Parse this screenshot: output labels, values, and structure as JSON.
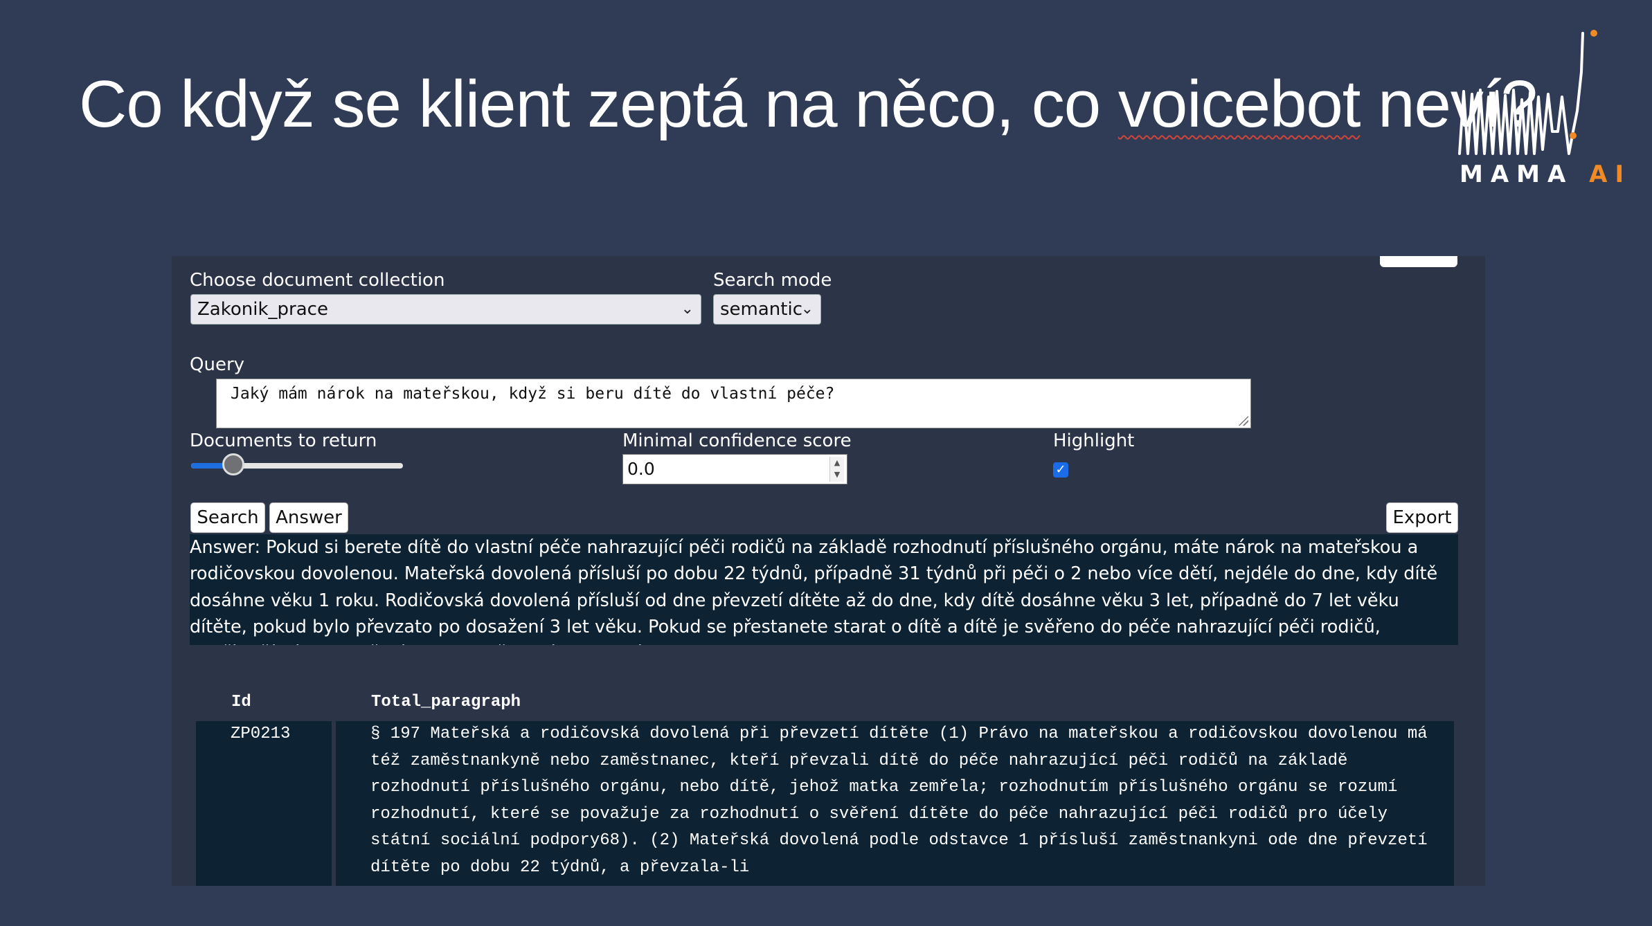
{
  "slide": {
    "title_before": "Co když se klient zeptá na něco, co ",
    "title_misspelled": "voicebot",
    "title_after": " neví?",
    "logo": {
      "word1": "MAMA",
      "word2": "AI",
      "accent": "#f08a24"
    }
  },
  "app": {
    "collection": {
      "label": "Choose document collection",
      "value": "Zakonik_prace"
    },
    "search_mode": {
      "label": "Search mode",
      "value": "semantic"
    },
    "query": {
      "label": "Query",
      "value": "Jaký mám nárok na mateřskou, když si beru dítě do vlastní péče?"
    },
    "documents": {
      "label": "Documents to return",
      "level_fraction": 0.2
    },
    "confidence": {
      "label": "Minimal confidence score",
      "value": "0.0"
    },
    "highlight": {
      "label": "Highlight",
      "checked": true
    },
    "buttons": {
      "search": "Search",
      "answer": "Answer",
      "export": "Export"
    },
    "answer_text": "Answer: Pokud si berete dítě do vlastní péče nahrazující péči rodičů na základě rozhodnutí příslušného orgánu, máte nárok na mateřskou a rodičovskou dovolenou. Mateřská dovolená přísluší po dobu 22 týdnů, případně 31 týdnů při péči o 2 nebo více dětí, nejdéle do dne, kdy dítě dosáhne věku 1 roku. Rodičovská dovolená přísluší od dne převzetí dítěte až do dne, kdy dítě dosáhne věku 3 let, případně do 7 let věku dítěte, pokud bylo převzato po dosažení 3 let věku. Pokud se přestanete starat o dítě a dítě je svěřeno do péče nahrazující péči rodičů, nepřísluší vám mateřská nebo rodičovská dovolená.",
    "table": {
      "columns": [
        "Id",
        "Total_paragraph"
      ],
      "rows": [
        {
          "id": "ZP0213",
          "paragraph": "§ 197  Mateřská a rodičovská dovolená při převzetí dítěte (1) Právo na mateřskou a rodičovskou dovolenou má též zaměstnankyně nebo zaměstnanec, kteří převzali dítě do péče nahrazující péči rodičů na základě rozhodnutí příslušného orgánu, nebo dítě, jehož matka zemřela; rozhodnutím příslušného orgánu se rozumí rozhodnutí, které se považuje za rozhodnutí o svěření dítěte do péče nahrazující péči rodičů pro účely státní sociální podpory68). (2) Mateřská dovolená podle odstavce 1 přísluší zaměstnankyni ode dne převzetí dítěte po dobu 22 týdnů, a převzala-li"
        }
      ]
    }
  }
}
